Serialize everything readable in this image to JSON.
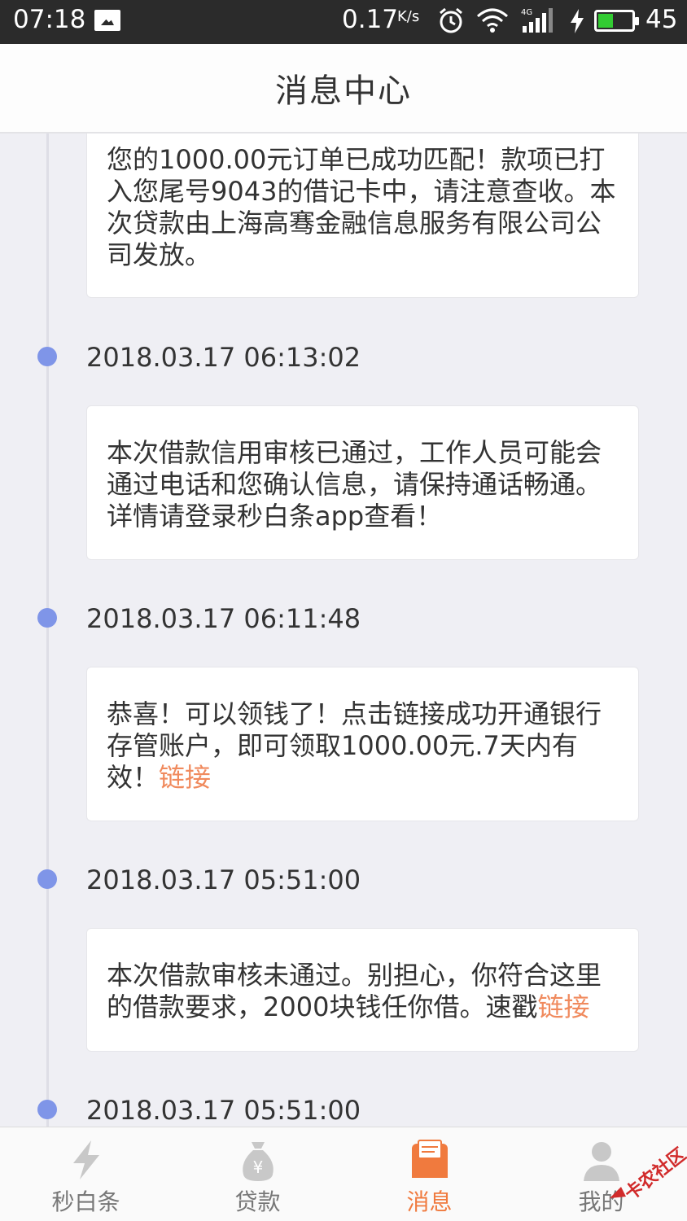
{
  "status_bar": {
    "time": "07:18",
    "speed": "0.17",
    "speed_unit": "K/s",
    "battery_level": "45",
    "signal_type": "4G",
    "icons": [
      "image-icon",
      "alarm-icon",
      "wifi-icon",
      "signal-icon",
      "charging-icon",
      "battery-icon"
    ]
  },
  "header": {
    "title": "消息中心"
  },
  "messages": [
    {
      "text": "您的1000.00元订单已成功匹配！款项已打入您尾号9043的借记卡中，请注意查收。本次贷款由上海高骞金融信息服务有限公司公司发放。",
      "link": ""
    },
    {
      "timestamp": "2018.03.17 06:13:02",
      "text": "本次借款信用审核已通过，工作人员可能会通过电话和您确认信息，请保持通话畅通。详情请登录秒白条app查看！",
      "link": ""
    },
    {
      "timestamp": "2018.03.17 06:11:48",
      "text": "恭喜！可以领钱了！点击链接成功开通银行存管账户，即可领取1000.00元.7天内有效！",
      "link": "链接"
    },
    {
      "timestamp": "2018.03.17 05:51:00",
      "text": "本次借款审核未通过。别担心，你符合这里的借款要求，2000块钱任你借。速戳",
      "link": "链接"
    },
    {
      "timestamp": "2018.03.17 05:51:00"
    }
  ],
  "tabs": [
    {
      "label": "秒白条",
      "icon": "lightning-icon",
      "active": false
    },
    {
      "label": "贷款",
      "icon": "money-bag-icon",
      "active": false
    },
    {
      "label": "消息",
      "icon": "message-icon",
      "active": true
    },
    {
      "label": "我的",
      "icon": "person-icon",
      "active": false
    }
  ],
  "watermark": {
    "text": "卡农社区"
  },
  "colors": {
    "accent": "#f07a3e",
    "link": "#f08a5d",
    "timeline_dot": "#7f95e8",
    "background": "#efeff4",
    "status_bar": "#2b2b2b"
  }
}
